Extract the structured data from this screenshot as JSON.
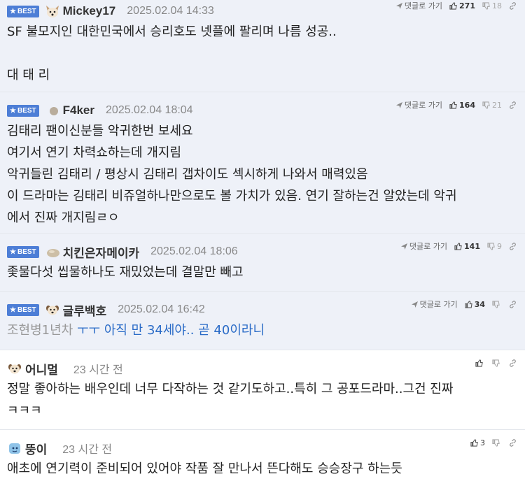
{
  "ui": {
    "best_label": "BEST",
    "reply_label": "댓글로 가기"
  },
  "comments": [
    {
      "best": true,
      "nick": "Mickey17",
      "avatar": "fox-face-icon",
      "date": "2025.02.04 14:33",
      "up": "271",
      "down": "18",
      "lines": [
        "SF 불모지인 대한민국에서 승리호도 넷플에 팔리며 나름 성공..",
        "",
        "대 태 리"
      ]
    },
    {
      "best": true,
      "nick": "F4ker",
      "avatar": "gray-dot-icon",
      "date": "2025.02.04 18:04",
      "up": "164",
      "down": "21",
      "lines": [
        "김태리 팬이신분들 악귀한번 보세요",
        "여기서 연기 차력쇼하는데 개지림",
        "악귀들린 김태리 / 평상시 김태리 갭차이도 섹시하게 나와서 매력있음",
        "이 드라마는 김태리 비쥬얼하나만으로도 볼 가치가 있음. 연기 잘하는건 알았는데 악귀",
        "에서 진짜 개지림ㄹㅇ"
      ]
    },
    {
      "best": true,
      "nick": "치킨은자메이카",
      "avatar": "chicken-blob-icon",
      "date": "2025.02.04 18:06",
      "up": "141",
      "down": "9",
      "lines": [
        "좇물다섯 씹물하나도 재밌었는데 결말만 빼고"
      ]
    },
    {
      "best": true,
      "nick": "글루백호",
      "avatar": "dog-face-icon",
      "date": "2025.02.04 16:42",
      "up": "34",
      "down": "",
      "quote_author": "조현병1년차",
      "quote_text": " ㅜㅜ 아직 만 34세야.. 곧 40이라니"
    },
    {
      "best": false,
      "nick": "어니멀",
      "avatar": "dog-face-icon",
      "date": "23 시간 전",
      "up": "",
      "down": "",
      "lines": [
        "정말 좋아하는 배우인데 너무 다작하는 것 같기도하고..특히 그 공포드라마..그건 진짜",
        "ㅋㅋㅋ"
      ]
    },
    {
      "best": false,
      "nick": "뚱이",
      "avatar": "blue-character-icon",
      "date": "23 시간 전",
      "up": "3",
      "down": "",
      "lines": [
        "애초에 연기력이 준비되어 있어야 작품 잘 만나서 뜬다해도 승승장구 하는듯"
      ]
    }
  ],
  "colors": {
    "best_bg": "#eef1f8",
    "badge": "#4d7ed6",
    "quote_link": "#2a6bc7"
  }
}
